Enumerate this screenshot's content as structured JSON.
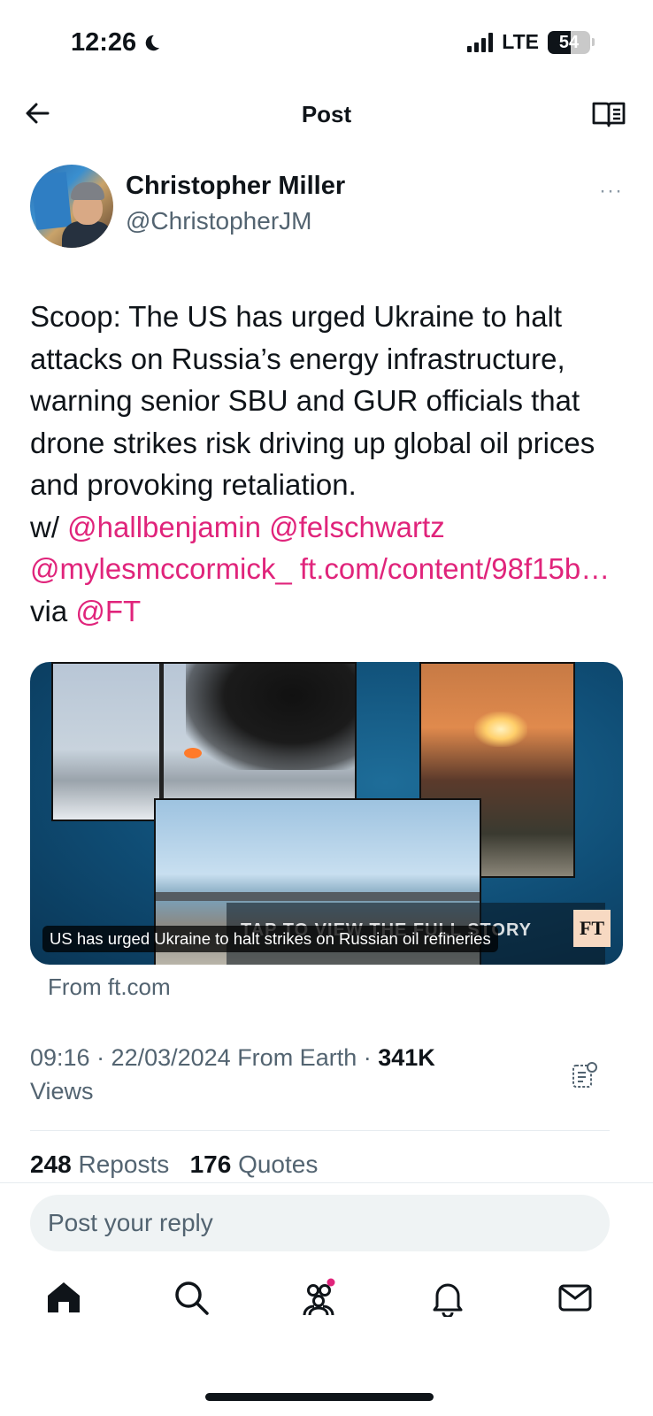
{
  "status_bar": {
    "time": "12:26",
    "network": "LTE",
    "battery": "54"
  },
  "header": {
    "title": "Post"
  },
  "author": {
    "name": "Christopher Miller",
    "handle": "@ChristopherJM",
    "more": "···"
  },
  "tweet": {
    "text_parts": [
      "Scoop: The US has urged Ukraine to halt attacks on Russia’s energy infrastructure, warning senior SBU and GUR officials that drone strikes risk driving up global oil prices and provoking retaliation.",
      "w/ ",
      "@hallbenjamin",
      " ",
      "@felschwartz",
      "@mylesmccormick_",
      " ",
      "ft.com/content/98f15b…",
      " via ",
      "@FT"
    ]
  },
  "card": {
    "caption": "US has urged Ukraine to halt strikes on Russian oil refineries",
    "banner": "TAP TO VIEW THE FULL STORY",
    "logo": "FT",
    "from": "From ft.com"
  },
  "meta": {
    "timestamp": "09:16 · 22/03/2024 From Earth ·",
    "views_count": "341K",
    "views_label": "Views"
  },
  "stats": {
    "reposts_count": "248",
    "reposts_label": "Reposts",
    "quotes_count": "176",
    "quotes_label": "Quotes"
  },
  "reply": {
    "placeholder": "Post your reply"
  },
  "tabbar": {
    "items": [
      "home-icon",
      "search-icon",
      "communities-icon",
      "notifications-icon",
      "messages-icon"
    ],
    "accent": "#e0247b"
  }
}
